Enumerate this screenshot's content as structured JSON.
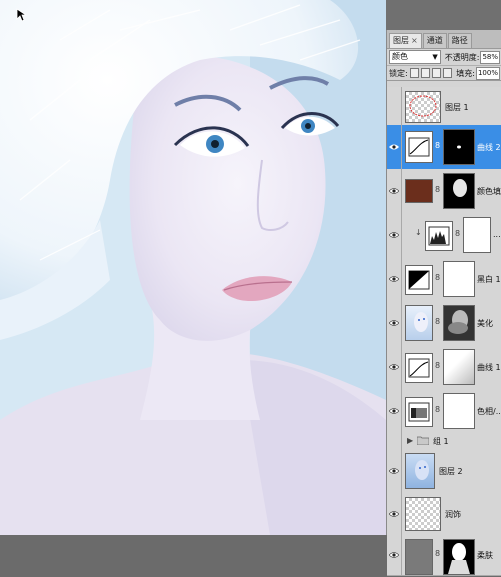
{
  "panel": {
    "tabs": [
      {
        "label": "图层",
        "close": "×"
      },
      {
        "label": "通道"
      },
      {
        "label": "路径"
      }
    ],
    "blend_mode": "颜色",
    "opacity_label": "不透明度:",
    "opacity_value": "58%",
    "lock_label": "锁定:",
    "fill_label": "填充:",
    "fill_value": "100%"
  },
  "layers": [
    {
      "name": "图层 1",
      "kind": "pixel-empty"
    },
    {
      "name": "曲线 2",
      "kind": "curves",
      "selected": true
    },
    {
      "name": "颜色填...",
      "kind": "color-fill"
    },
    {
      "name": "...",
      "kind": "levels"
    },
    {
      "name": "黑白 1",
      "kind": "black-white"
    },
    {
      "name": "美化",
      "kind": "photo"
    },
    {
      "name": "曲线 1",
      "kind": "curves"
    },
    {
      "name": "色相/...",
      "kind": "hue"
    },
    {
      "name": "组 1",
      "kind": "group"
    },
    {
      "name": "图层 2",
      "kind": "photo"
    },
    {
      "name": "润饰",
      "kind": "pixel-empty"
    },
    {
      "name": "柔肤",
      "kind": "gray-photo"
    }
  ],
  "colors": {
    "selection": "#3a8ee6",
    "fill_swatch": "#6b2e1c",
    "panel_bg": "#d4d4d4"
  }
}
